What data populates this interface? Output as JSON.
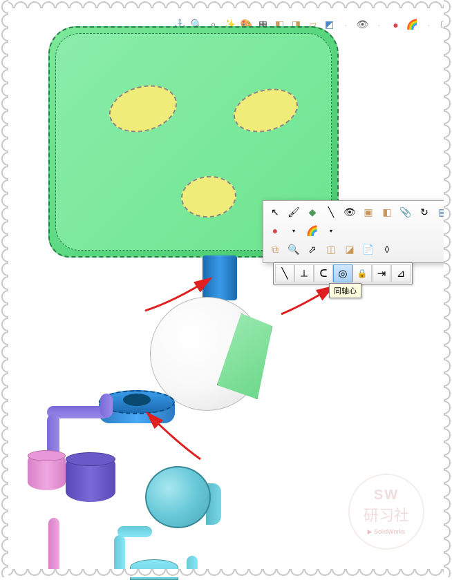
{
  "top_toolbar": {
    "icons": [
      "anchor-icon",
      "zoom-fit-icon",
      "zoom-area-icon",
      "wand-icon",
      "palette-icon",
      "display-style-icon",
      "box-solid-icon",
      "box-wire-icon",
      "perspective-icon",
      "cube-icon",
      "eye-icon",
      "sphere-red-icon",
      "sphere-multi-icon",
      "monitor-icon"
    ]
  },
  "context_menu": {
    "row1_icons": [
      "select-icon",
      "brush-icon",
      "diamond-green-icon",
      "line-icon",
      "eye-menu-icon",
      "boxes-icon",
      "box-yellow-icon",
      "paperclip-icon",
      "rotate-cw-icon",
      "panel-icon"
    ],
    "row2_icons": [
      "sphere-red-icon",
      "sphere-multi-icon"
    ],
    "row3_icons": [
      "assembly-icon",
      "zoom-select-icon",
      "cursor-icon",
      "cube2-icon",
      "cube3-icon",
      "document-icon",
      "eraser-icon"
    ]
  },
  "mates_toolbar": {
    "items": [
      {
        "name": "coincident-mate",
        "glyph": "╲"
      },
      {
        "name": "perpendicular-mate",
        "glyph": "⟂"
      },
      {
        "name": "tangent-mate",
        "glyph": "∂"
      },
      {
        "name": "concentric-mate",
        "glyph": "◎",
        "active": true
      },
      {
        "name": "lock-mate",
        "glyph": "🔒"
      },
      {
        "name": "distance-mate",
        "glyph": "↔"
      },
      {
        "name": "angle-mate",
        "glyph": "∠"
      }
    ]
  },
  "tooltip": {
    "text": "同轴心"
  },
  "watermark": {
    "top": "SW",
    "mid": "研习社",
    "bot": "SolidWorks"
  },
  "colors": {
    "head_green": "#6de48f",
    "eye_yellow": "#f0ec7a",
    "neck_blue": "#3a9ae8",
    "pipe_purple": "#7a6ad8",
    "pink": "#e898d8",
    "indigo": "#6a5ac8",
    "cyan": "#68c8d8",
    "arrow_red": "#e02020"
  }
}
